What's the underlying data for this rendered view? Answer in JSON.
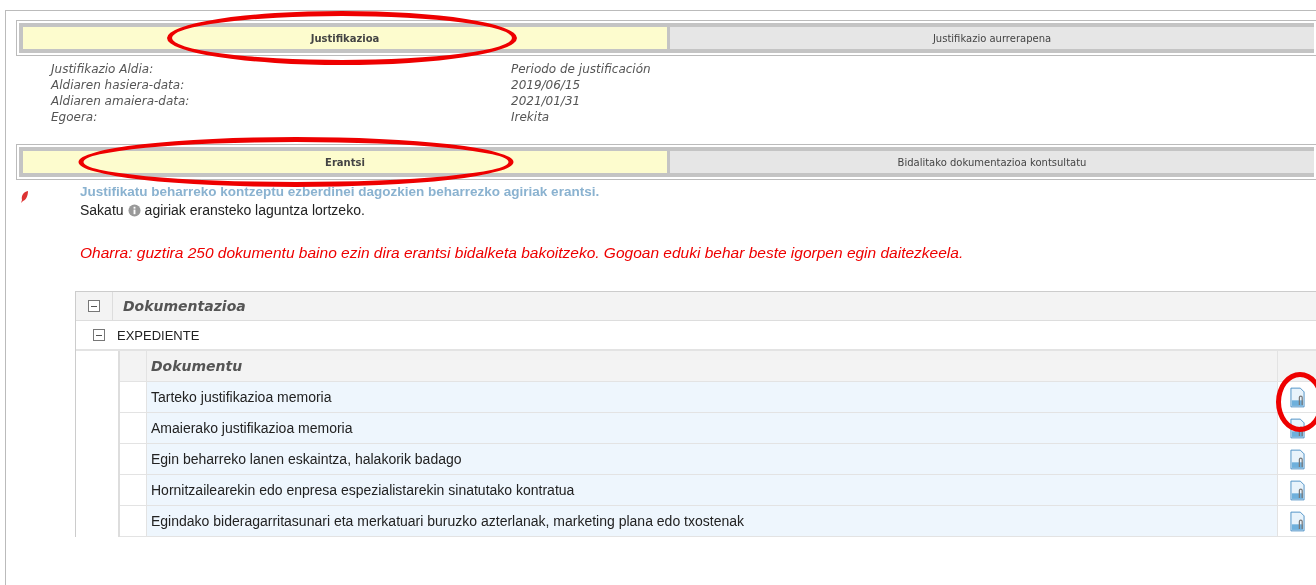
{
  "top_tabs": [
    {
      "label": "Justifikazioa",
      "selected": true,
      "circled": true
    },
    {
      "label": "Justifikazio aurrerapena",
      "selected": false,
      "circled": false
    }
  ],
  "fields": [
    {
      "label": "Justifikazio Aldia:",
      "value": "Periodo de justificación"
    },
    {
      "label": "Aldiaren hasiera-data:",
      "value": "2019/06/15"
    },
    {
      "label": "Aldiaren amaiera-data:",
      "value": "2021/01/31"
    },
    {
      "label": "Egoera:",
      "value": "Irekita"
    }
  ],
  "section_tabs": [
    {
      "label": "Erantsi",
      "selected": true,
      "circled": true
    },
    {
      "label": "Bidalitako dokumentazioa kontsultatu",
      "selected": false,
      "circled": false
    }
  ],
  "intro": "Justifikatu beharreko kontzeptu ezberdinei dagozkien beharrezko agiriak erantsi.",
  "help_before": "Sakatu",
  "help_after": "agiriak eransteko laguntza lortzeko.",
  "note": "Oharra: guztira 250 dokumentu baino ezin dira erantsi bidalketa bakoitzeko. Gogoan eduki behar beste igorpen egin daitezkeela.",
  "tree": {
    "title": "Dokumentazioa",
    "expanded": true,
    "group": {
      "label": "EXPEDIENTE",
      "expanded": true,
      "column": "Dokumentu",
      "rows": [
        {
          "name": "Tarteko justifikazioa memoria",
          "circled": true
        },
        {
          "name": "Amaierako justifikazioa memoria",
          "circled": false
        },
        {
          "name": "Egin beharreko lanen eskaintza, halakorik badago",
          "circled": false
        },
        {
          "name": "Hornitzailearekin edo enpresa espezialistarekin sinatutako kontratua",
          "circled": false
        },
        {
          "name": "Egindako bideragarritasunari eta merkatuari buruzko azterlanak, marketing plana edo txostenak",
          "circled": false
        }
      ]
    }
  }
}
